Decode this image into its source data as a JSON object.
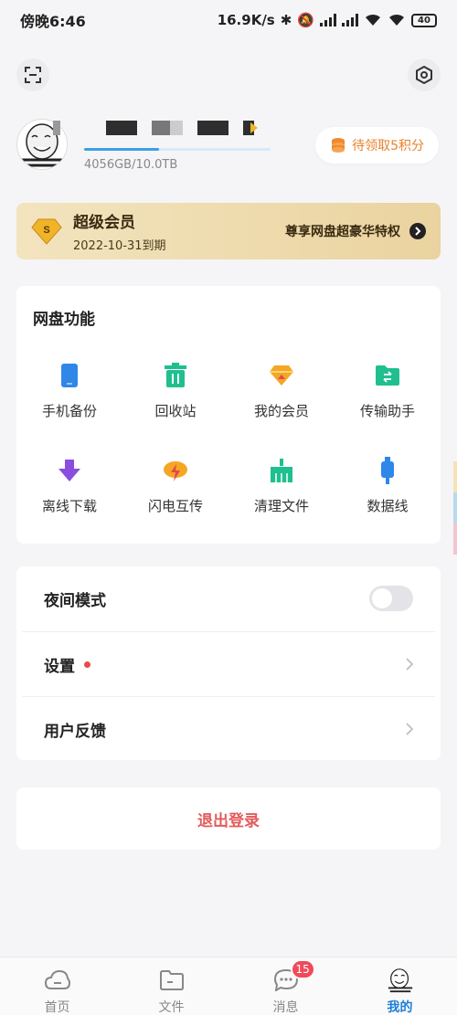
{
  "status_bar": {
    "time": "傍晚6:46",
    "net_speed": "16.9K/s",
    "battery": "40"
  },
  "header": {
    "scan_icon": "scan-icon",
    "settings_icon": "gear-icon"
  },
  "profile": {
    "avatar_icon": "meme-avatar-icon",
    "storage_text": "4056GB/10.0TB",
    "storage_used_fraction": 0.4,
    "points_label": "待领取5积分"
  },
  "vip": {
    "title": "超级会员",
    "expiry": "2022-10-31到期",
    "promo": "尊享网盘超豪华特权"
  },
  "features": {
    "title": "网盘功能",
    "items": [
      {
        "label": "手机备份",
        "icon": "phone-backup-icon",
        "color": "#2f87e8"
      },
      {
        "label": "回收站",
        "icon": "trash-icon",
        "color": "#1fbf8f"
      },
      {
        "label": "我的会员",
        "icon": "diamond-icon",
        "color": "#f5a623"
      },
      {
        "label": "传输助手",
        "icon": "transfer-folder-icon",
        "color": "#1fbf8f"
      },
      {
        "label": "离线下载",
        "icon": "download-arrow-icon",
        "color": "#8a4de0"
      },
      {
        "label": "闪电互传",
        "icon": "lightning-cloud-icon",
        "color": "#f5a623"
      },
      {
        "label": "清理文件",
        "icon": "broom-icon",
        "color": "#1fbf8f"
      },
      {
        "label": "数据线",
        "icon": "usb-cable-icon",
        "color": "#2f87e8"
      }
    ]
  },
  "settings_list": {
    "night_mode": "夜间模式",
    "night_mode_on": false,
    "settings": "设置",
    "feedback": "用户反馈"
  },
  "logout": "退出登录",
  "tabs": [
    {
      "label": "首页",
      "icon": "cloud-home-icon"
    },
    {
      "label": "文件",
      "icon": "folder-icon"
    },
    {
      "label": "消息",
      "icon": "chat-icon",
      "badge": "15"
    },
    {
      "label": "我的",
      "icon": "meme-avatar-icon",
      "active": true
    }
  ],
  "colors": {
    "accent": "#1e7fd8",
    "points": "#e7832b",
    "logout": "#e25c5c",
    "badge": "#ef4a5a"
  }
}
